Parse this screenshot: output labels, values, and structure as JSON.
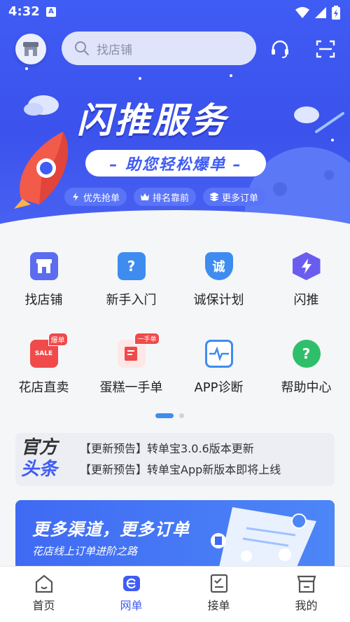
{
  "status": {
    "time": "4:32",
    "badge": "A"
  },
  "header": {
    "search_placeholder": "找店铺"
  },
  "banner": {
    "title": "闪推服务",
    "subtitle": "– 助您轻松爆单 –",
    "tags": [
      "优先抢单",
      "排名靠前",
      "更多订单"
    ]
  },
  "grid": {
    "row1": [
      {
        "label": "找店铺",
        "icon": "store-icon",
        "color": "#5b6cf0"
      },
      {
        "label": "新手入门",
        "icon": "question-icon",
        "color": "#3f8cf0"
      },
      {
        "label": "诚保计划",
        "icon": "shield-icon",
        "color": "#3f8cf0",
        "glyph": "诚"
      },
      {
        "label": "闪推",
        "icon": "lightning-icon",
        "color": "#6b5cf0"
      }
    ],
    "row2": [
      {
        "label": "花店直卖",
        "icon": "sale-icon",
        "color": "#f04a4a",
        "badge": "爆单",
        "glyph": "SALE"
      },
      {
        "label": "蛋糕一手单",
        "icon": "cake-order-icon",
        "color": "#f04a4a",
        "badge": "一手单"
      },
      {
        "label": "APP诊断",
        "icon": "diagnosis-icon",
        "color": "#3f8cf0"
      },
      {
        "label": "帮助中心",
        "icon": "help-icon",
        "color": "#2fbf6a",
        "glyph": "?"
      }
    ]
  },
  "news": {
    "logo_line1": "官方",
    "logo_line2": "头条",
    "items": [
      "【更新预告】转单宝3.0.6版本更新",
      "【更新预告】转单宝App新版本即将上线"
    ]
  },
  "promo": {
    "title": "更多渠道，更多订单",
    "subtitle": "花店线上订单进阶之路"
  },
  "tabbar": {
    "tabs": [
      {
        "label": "首页",
        "icon": "home-icon"
      },
      {
        "label": "网单",
        "icon": "web-order-icon"
      },
      {
        "label": "接单",
        "icon": "receive-order-icon"
      },
      {
        "label": "我的",
        "icon": "shop-profile-icon"
      }
    ],
    "active_index": 1
  },
  "colors": {
    "primary": "#3f5cf4",
    "accent": "#3f8cf0"
  }
}
